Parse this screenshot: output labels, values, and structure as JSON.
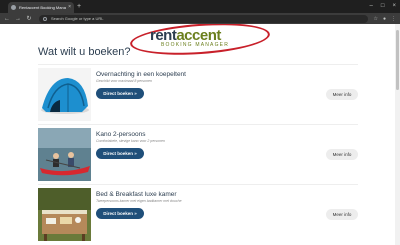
{
  "browser": {
    "tab_title": "Rentaccent Booking Manager",
    "tab_close": "×",
    "new_tab": "+",
    "omnibox_placeholder": "Search Google or type a URL",
    "window_controls": [
      "–",
      "□",
      "×"
    ]
  },
  "logo": {
    "word_1": "rent",
    "word_2": "accent",
    "subtitle": "BOOKING MANAGER",
    "ring_color": "#c8202a"
  },
  "page": {
    "title": "Wat wilt u boeken?"
  },
  "items": [
    {
      "name": "Overnachting in een koepeltent",
      "description": "Geschikt voor maximaal 8 personen",
      "book_label": "Direct boeken »",
      "info_label": "Meer info"
    },
    {
      "name": "Kano 2-persoons",
      "description": "Comfortabele, stevige kano voor 2 personen",
      "book_label": "Direct boeken »",
      "info_label": "Meer info"
    },
    {
      "name": "Bed & Breakfast luxe kamer",
      "description": "Tweepersoons kamer met eigen badkamer met douche",
      "book_label": "Direct boeken »",
      "info_label": "Meer info"
    }
  ],
  "colors": {
    "primary_button": "#1f4f7a",
    "heading_text": "#2c3e50",
    "accent_green": "#6b7f1d"
  }
}
